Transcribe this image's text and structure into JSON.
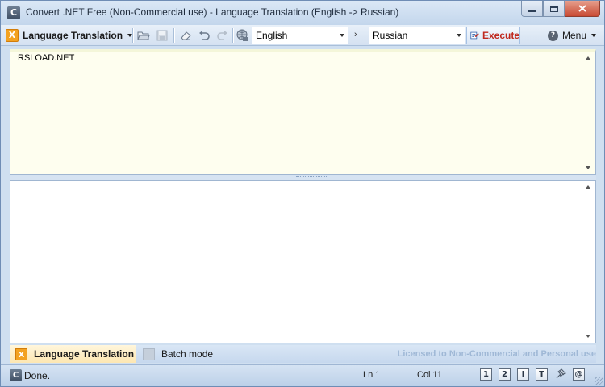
{
  "window": {
    "title": "Convert .NET Free (Non-Commercial use) - Language Translation (English -> Russian)",
    "app_icon_letter": "C"
  },
  "toolbar": {
    "mode_label": "Language Translation",
    "mode_icon_glyph": "X",
    "source_language": "English",
    "target_language": "Russian",
    "separator_glyph": "›",
    "execute_label": "Execute",
    "menu_label": "Menu",
    "help_glyph": "?",
    "icons": [
      "open-folder-icon",
      "save-icon",
      "eraser-icon",
      "undo-icon",
      "redo-icon",
      "language-globe-icon",
      "execute-icon",
      "help-icon"
    ]
  },
  "editors": {
    "source_text": "RSLOAD.NET",
    "target_text": ""
  },
  "tabs": {
    "active_label": "Language Translation",
    "batch_label": "Batch mode",
    "license_text": "Licensed to Non-Commercial and Personal use"
  },
  "status": {
    "text": "Done.",
    "line": "Ln 1",
    "column": "Col 11",
    "button_labels": [
      "1",
      "2",
      "I",
      "T",
      "@"
    ]
  },
  "colors": {
    "accent_orange": "#f3a221",
    "execute_red": "#c0281e",
    "source_editor_bg": "#fefeef",
    "license_text": "#9fb8d6"
  }
}
